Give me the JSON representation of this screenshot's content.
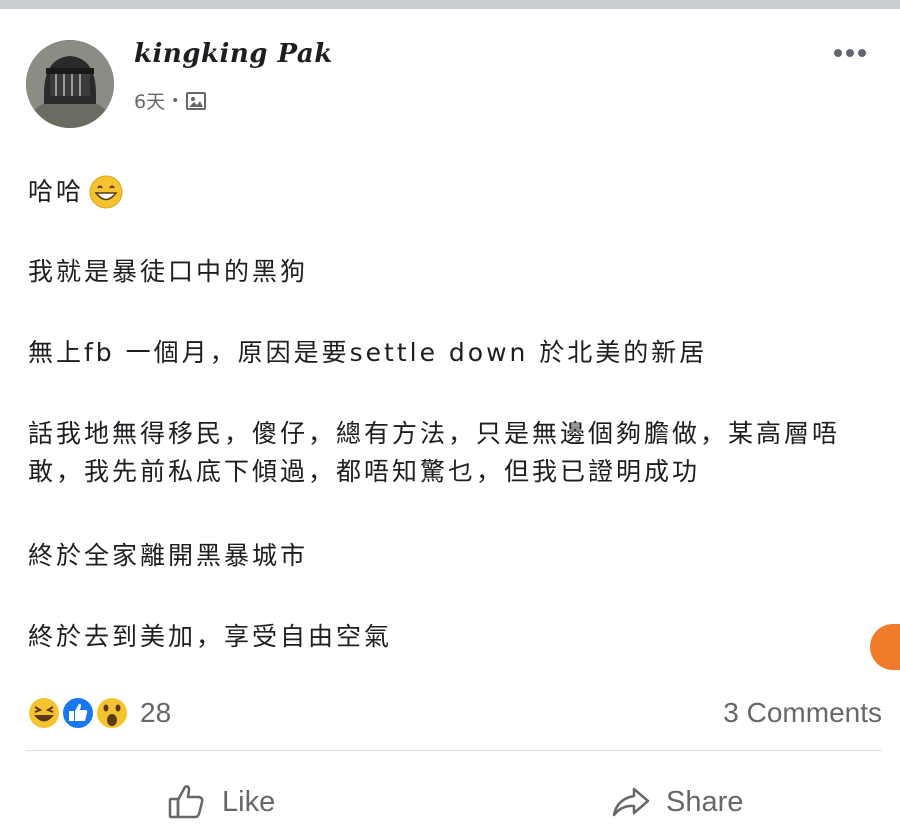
{
  "post": {
    "author": "kingking Pak",
    "time": "6天",
    "separator": "•",
    "audience_icon": "photo-icon",
    "more_icon": "more-options-icon",
    "paragraphs": [
      "哈哈",
      "我就是暴徒口中的黑狗",
      "無上fb 一個月，原因是要settle down 於北美的新居",
      "話我地無得移民，傻仔，總有方法，只是無邊個夠膽做，某高層唔敢，我先前私底下傾過，都唔知驚乜，但我已證明成功",
      "終於全家離開黑暴城市",
      "終於去到美加，享受自由空氣"
    ],
    "first_paragraph_emoji": "grinning-face-emoji"
  },
  "reactions": {
    "icons": [
      "laughing-reaction-icon",
      "like-reaction-icon",
      "wow-reaction-icon"
    ],
    "count": "28",
    "comments": "3 Comments"
  },
  "actions": {
    "like_label": "Like",
    "share_label": "Share"
  },
  "colors": {
    "text": "#1c1e21",
    "secondary": "#65676b",
    "like_blue": "#1877f2",
    "reaction_yellow": "#f5c330",
    "badge_orange": "#f07b2b"
  }
}
